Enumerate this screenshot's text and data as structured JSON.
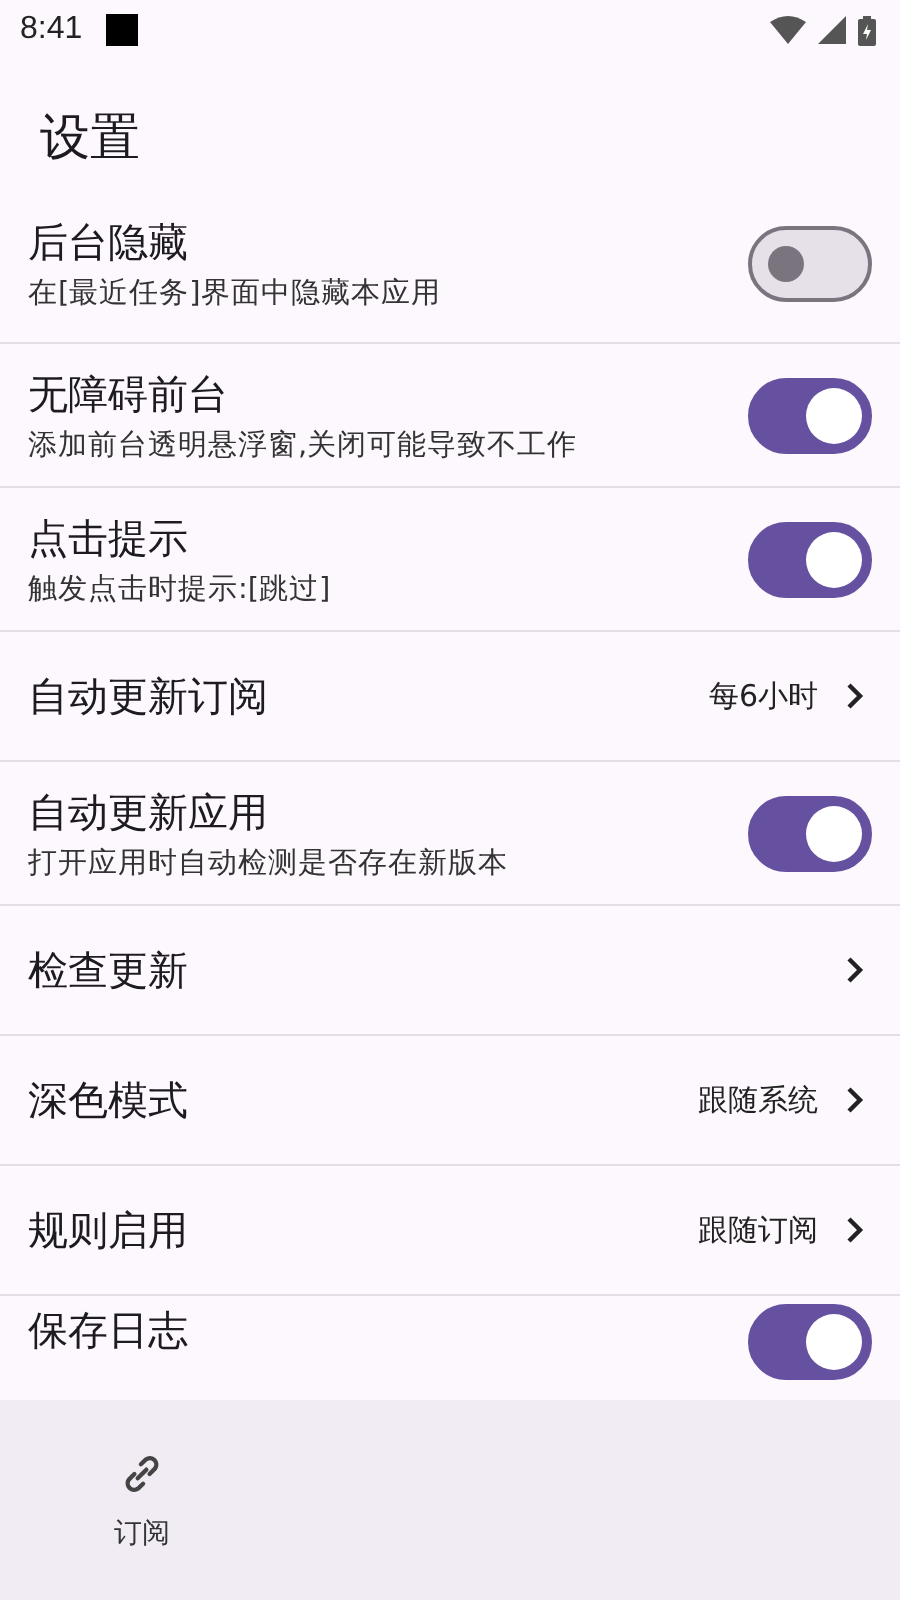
{
  "status_bar": {
    "time": "8:41"
  },
  "title": "设置",
  "settings": [
    {
      "kind": "toggle",
      "label": "后台隐藏",
      "subtitle": "在[最近任务]界面中隐藏本应用",
      "on": false
    },
    {
      "kind": "toggle",
      "label": "无障碍前台",
      "subtitle": "添加前台透明悬浮窗,关闭可能导致不工作",
      "on": true
    },
    {
      "kind": "toggle",
      "label": "点击提示",
      "subtitle": "触发点击时提示:[跳过]",
      "on": true
    },
    {
      "kind": "link",
      "label": "自动更新订阅",
      "value": "每6小时"
    },
    {
      "kind": "toggle",
      "label": "自动更新应用",
      "subtitle": "打开应用时自动检测是否存在新版本",
      "on": true
    },
    {
      "kind": "link",
      "label": "检查更新"
    },
    {
      "kind": "link",
      "label": "深色模式",
      "value": "跟随系统"
    },
    {
      "kind": "link",
      "label": "规则启用",
      "value": "跟随订阅"
    },
    {
      "kind": "toggle",
      "label": "保存日志",
      "on": true
    }
  ],
  "bottom_nav": [
    {
      "label": "订阅"
    }
  ]
}
